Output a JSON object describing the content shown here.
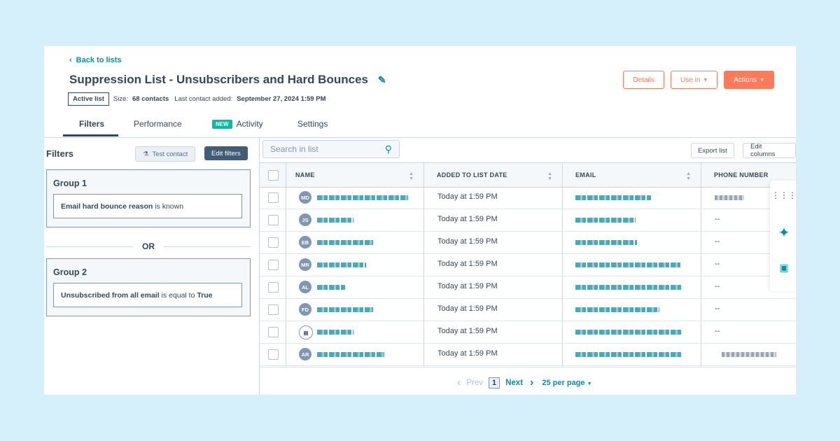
{
  "header": {
    "back_label": "Back to lists",
    "title": "Suppression List - Unsubscribers and Hard Bounces",
    "active_badge": "Active list",
    "size_prefix": "Size:",
    "size_value": "68 contacts",
    "last_added_prefix": "Last contact added:",
    "last_added_value": "September 27, 2024 1:59 PM",
    "buttons": {
      "details": "Details",
      "use_in": "Use in",
      "actions": "Actions"
    }
  },
  "tabs": [
    {
      "label": "Filters",
      "active": true
    },
    {
      "label": "Performance"
    },
    {
      "label": "Activity",
      "badge": "NEW"
    },
    {
      "label": "Settings"
    }
  ],
  "filters": {
    "title": "Filters",
    "test_contact": "Test contact",
    "edit_filters": "Edit filters",
    "or_label": "OR",
    "groups": [
      {
        "title": "Group 1",
        "cond_field": "Email hard bounce reason",
        "cond_op": "is known",
        "cond_value": ""
      },
      {
        "title": "Group 2",
        "cond_field": "Unsubscribed from all email",
        "cond_op": "is equal to",
        "cond_value": "True"
      }
    ]
  },
  "table": {
    "search_placeholder": "Search in list",
    "export": "Export list",
    "edit_columns": "Edit columns",
    "columns": [
      "NAME",
      "ADDED TO LIST DATE",
      "EMAIL",
      "PHONE NUMBER"
    ],
    "rows": [
      {
        "initials": "MD",
        "date": "Today at 1:59 PM",
        "phone": ""
      },
      {
        "initials": "JS",
        "date": "Today at 1:59 PM",
        "phone": "--"
      },
      {
        "initials": "EB",
        "date": "Today at 1:59 PM",
        "phone": "--"
      },
      {
        "initials": "MR",
        "date": "Today at 1:59 PM",
        "phone": "--"
      },
      {
        "initials": "AL",
        "date": "Today at 1:59 PM",
        "phone": "--"
      },
      {
        "initials": "FD",
        "date": "Today at 1:59 PM",
        "phone": "--"
      },
      {
        "initials": "",
        "date": "Today at 1:59 PM",
        "phone": "--"
      },
      {
        "initials": "AR",
        "date": "Today at 1:59 PM",
        "phone": ""
      }
    ]
  },
  "pagination": {
    "prev": "Prev",
    "page": "1",
    "next": "Next",
    "per_page": "25 per page"
  },
  "colors": {
    "accent": "#ff7a59",
    "link": "#0091ae",
    "text": "#33475b",
    "new_badge": "#00bda5"
  }
}
